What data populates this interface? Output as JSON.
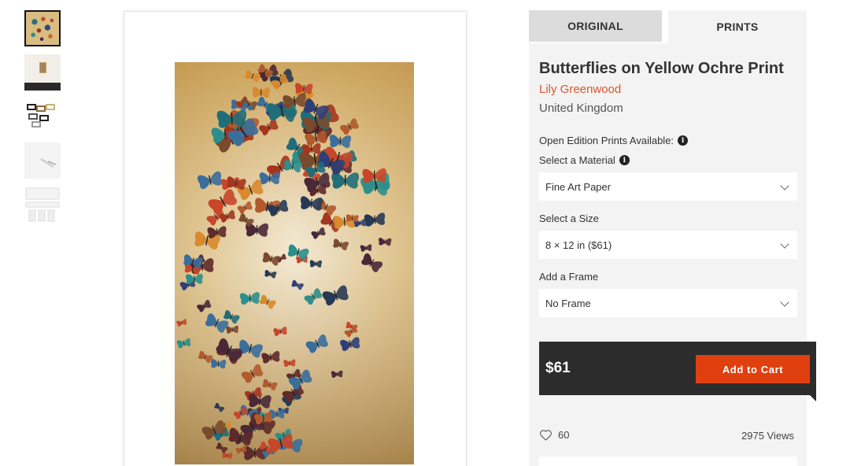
{
  "thumbnails": [
    {
      "name": "artwork-main",
      "active": true
    },
    {
      "name": "artwork-framed-room",
      "active": false
    },
    {
      "name": "frame-options",
      "active": false
    },
    {
      "name": "artwork-side-view",
      "active": false
    },
    {
      "name": "artwork-details",
      "active": false
    }
  ],
  "tabs": [
    {
      "label": "ORIGINAL",
      "active": false
    },
    {
      "label": "PRINTS",
      "active": true
    }
  ],
  "product": {
    "title": "Butterflies on Yellow Ochre Print",
    "artist": "Lily Greenwood",
    "country": "United Kingdom"
  },
  "options": {
    "edition_label": "Open Edition Prints Available:",
    "material_label": "Select a Material",
    "material_value": "Fine Art Paper",
    "size_label": "Select a Size",
    "size_value": "8 × 12 in ($61)",
    "frame_label": "Add a Frame",
    "frame_value": "No Frame"
  },
  "purchase": {
    "price": "$61",
    "cart_label": "Add to Cart"
  },
  "stats": {
    "likes": "60",
    "views": "2975 Views"
  },
  "colors": {
    "accent": "#e0532e",
    "cart_button": "#e0400f",
    "buybar_bg": "#2c2c2c",
    "panel_bg": "#f3f3f3"
  },
  "icons": [
    "info-icon",
    "chevron-down-icon",
    "heart-icon"
  ]
}
